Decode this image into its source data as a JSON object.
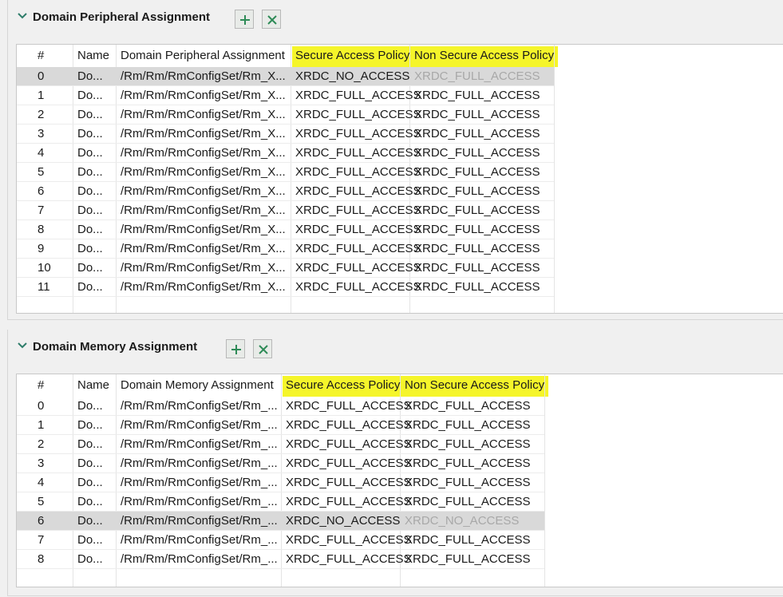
{
  "colors": {
    "highlight": "#f5f52a",
    "selected_row": "#d9d9d9",
    "add_icon": "#2e8b57",
    "remove_icon": "#2e8b57"
  },
  "peripheral": {
    "title": "Domain Peripheral Assignment",
    "add_icon": "plus-icon",
    "remove_icon": "x-icon",
    "columns": [
      "#",
      "Name",
      "Domain Peripheral Assignment",
      "Secure Access Policy",
      "Non Secure Access Policy"
    ],
    "rows": [
      {
        "num": "0",
        "name": "Do...",
        "path": "/Rm/Rm/RmConfigSet/Rm_X...",
        "secure": "XRDC_NO_ACCESS",
        "nonsecure": "XRDC_FULL_ACCESS"
      },
      {
        "num": "1",
        "name": "Do...",
        "path": "/Rm/Rm/RmConfigSet/Rm_X...",
        "secure": "XRDC_FULL_ACCESS",
        "nonsecure": "XRDC_FULL_ACCESS"
      },
      {
        "num": "2",
        "name": "Do...",
        "path": "/Rm/Rm/RmConfigSet/Rm_X...",
        "secure": "XRDC_FULL_ACCESS",
        "nonsecure": "XRDC_FULL_ACCESS"
      },
      {
        "num": "3",
        "name": "Do...",
        "path": "/Rm/Rm/RmConfigSet/Rm_X...",
        "secure": "XRDC_FULL_ACCESS",
        "nonsecure": "XRDC_FULL_ACCESS"
      },
      {
        "num": "4",
        "name": "Do...",
        "path": "/Rm/Rm/RmConfigSet/Rm_X...",
        "secure": "XRDC_FULL_ACCESS",
        "nonsecure": "XRDC_FULL_ACCESS"
      },
      {
        "num": "5",
        "name": "Do...",
        "path": "/Rm/Rm/RmConfigSet/Rm_X...",
        "secure": "XRDC_FULL_ACCESS",
        "nonsecure": "XRDC_FULL_ACCESS"
      },
      {
        "num": "6",
        "name": "Do...",
        "path": "/Rm/Rm/RmConfigSet/Rm_X...",
        "secure": "XRDC_FULL_ACCESS",
        "nonsecure": "XRDC_FULL_ACCESS"
      },
      {
        "num": "7",
        "name": "Do...",
        "path": "/Rm/Rm/RmConfigSet/Rm_X...",
        "secure": "XRDC_FULL_ACCESS",
        "nonsecure": "XRDC_FULL_ACCESS"
      },
      {
        "num": "8",
        "name": "Do...",
        "path": "/Rm/Rm/RmConfigSet/Rm_X...",
        "secure": "XRDC_FULL_ACCESS",
        "nonsecure": "XRDC_FULL_ACCESS"
      },
      {
        "num": "9",
        "name": "Do...",
        "path": "/Rm/Rm/RmConfigSet/Rm_X...",
        "secure": "XRDC_FULL_ACCESS",
        "nonsecure": "XRDC_FULL_ACCESS"
      },
      {
        "num": "10",
        "name": "Do...",
        "path": "/Rm/Rm/RmConfigSet/Rm_X...",
        "secure": "XRDC_FULL_ACCESS",
        "nonsecure": "XRDC_FULL_ACCESS"
      },
      {
        "num": "11",
        "name": "Do...",
        "path": "/Rm/Rm/RmConfigSet/Rm_X...",
        "secure": "XRDC_FULL_ACCESS",
        "nonsecure": "XRDC_FULL_ACCESS"
      }
    ]
  },
  "memory": {
    "title": "Domain Memory Assignment",
    "add_icon": "plus-icon",
    "remove_icon": "x-icon",
    "columns": [
      "#",
      "Name",
      "Domain Memory Assignment",
      "Secure Access Policy",
      "Non Secure Access Policy"
    ],
    "rows": [
      {
        "num": "0",
        "name": "Do...",
        "path": "/Rm/Rm/RmConfigSet/Rm_...",
        "secure": "XRDC_FULL_ACCESS",
        "nonsecure": "XRDC_FULL_ACCESS"
      },
      {
        "num": "1",
        "name": "Do...",
        "path": "/Rm/Rm/RmConfigSet/Rm_...",
        "secure": "XRDC_FULL_ACCESS",
        "nonsecure": "XRDC_FULL_ACCESS"
      },
      {
        "num": "2",
        "name": "Do...",
        "path": "/Rm/Rm/RmConfigSet/Rm_...",
        "secure": "XRDC_FULL_ACCESS",
        "nonsecure": "XRDC_FULL_ACCESS"
      },
      {
        "num": "3",
        "name": "Do...",
        "path": "/Rm/Rm/RmConfigSet/Rm_...",
        "secure": "XRDC_FULL_ACCESS",
        "nonsecure": "XRDC_FULL_ACCESS"
      },
      {
        "num": "4",
        "name": "Do...",
        "path": "/Rm/Rm/RmConfigSet/Rm_...",
        "secure": "XRDC_FULL_ACCESS",
        "nonsecure": "XRDC_FULL_ACCESS"
      },
      {
        "num": "5",
        "name": "Do...",
        "path": "/Rm/Rm/RmConfigSet/Rm_...",
        "secure": "XRDC_FULL_ACCESS",
        "nonsecure": "XRDC_FULL_ACCESS"
      },
      {
        "num": "6",
        "name": "Do...",
        "path": "/Rm/Rm/RmConfigSet/Rm_...",
        "secure": "XRDC_NO_ACCESS",
        "nonsecure": "XRDC_NO_ACCESS"
      },
      {
        "num": "7",
        "name": "Do...",
        "path": "/Rm/Rm/RmConfigSet/Rm_...",
        "secure": "XRDC_FULL_ACCESS",
        "nonsecure": "XRDC_FULL_ACCESS"
      },
      {
        "num": "8",
        "name": "Do...",
        "path": "/Rm/Rm/RmConfigSet/Rm_...",
        "secure": "XRDC_FULL_ACCESS",
        "nonsecure": "XRDC_FULL_ACCESS"
      }
    ]
  }
}
